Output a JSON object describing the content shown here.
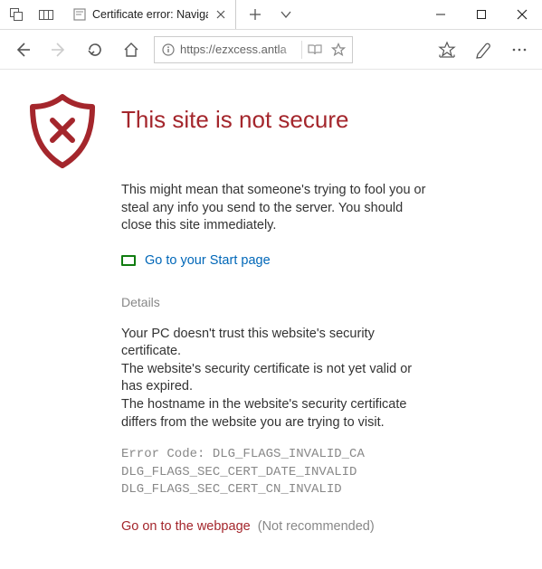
{
  "window": {
    "tab_title": "Certificate error: Naviga"
  },
  "addressbar": {
    "url": "https://ezxcess.antla"
  },
  "page": {
    "heading": "This site is not secure",
    "warning_para": "This might mean that someone's trying to fool you or steal any info you send to the server. You should close this site immediately.",
    "start_link": "Go to your Start page",
    "details_heading": "Details",
    "details_line1": "Your PC doesn't trust this website's security certificate.",
    "details_line2": "The website's security certificate is not yet valid or has expired.",
    "details_line3": "The hostname in the website's security certificate differs from the website you are trying to visit.",
    "error_code_prefix": "Error Code: ",
    "error_codes": [
      "DLG_FLAGS_INVALID_CA",
      "DLG_FLAGS_SEC_CERT_DATE_INVALID",
      "DLG_FLAGS_SEC_CERT_CN_INVALID"
    ],
    "proceed_link": "Go on to the webpage",
    "proceed_note": "(Not recommended)"
  },
  "colors": {
    "danger": "#a4262c",
    "link_blue": "#0067b8",
    "start_green": "#107c10",
    "muted": "#888888"
  }
}
